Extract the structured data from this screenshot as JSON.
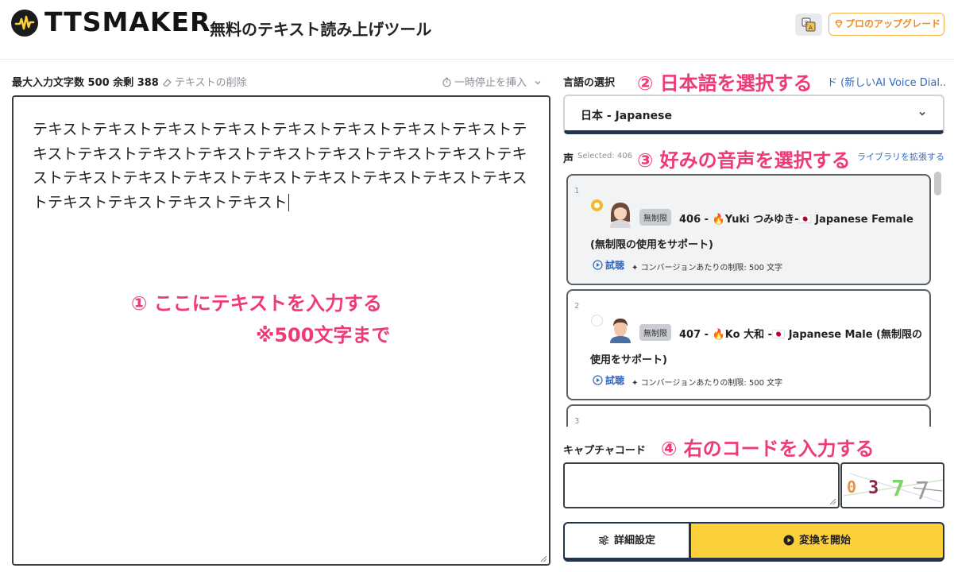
{
  "header": {
    "logo_text": "TTSMAKER",
    "title": "無料のテキスト読み上げツール",
    "upgrade_label": "プロのアップグレード"
  },
  "editor": {
    "max_chars_text": "最大入力文字数 500 余剰 388",
    "clear_label": "テキストの削除",
    "pause_label": "一時停止を挿入",
    "text": "テキストテキストテキストテキストテキストテキストテキストテキストテキストテキストテキストテキストテキストテキストテキストテキストテキストテキストテキストテキストテキストテキストテキストテキストテキストテキストテキストテキストテキスト"
  },
  "language": {
    "label": "言語の選択",
    "dialect_link": "ド (新しいAI Voice Dial...",
    "selected": "日本 - Japanese"
  },
  "voice": {
    "label": "声",
    "selected_text": "Selected: 406",
    "library_link": "ライブラリを拡張する",
    "items": [
      {
        "num": "1",
        "tag": "無制限",
        "name": "406 - 🔥Yuki つみゆき-🇯🇵 Japanese Female (無制限の使用をサポート)",
        "try_label": "試聴",
        "limit": "コンバージョンあたりの制限: 500 文字"
      },
      {
        "num": "2",
        "tag": "無制限",
        "name": "407 - 🔥Ko 大和 -🇯🇵 Japanese Male (無制限の使用をサポート)",
        "try_label": "試聴",
        "limit": "コンバージョンあたりの制限: 500 文字"
      },
      {
        "num": "3"
      }
    ]
  },
  "captcha": {
    "label": "キャプチャコード",
    "code": "0 3 7 7"
  },
  "actions": {
    "settings_label": "詳細設定",
    "start_label": "変換を開始"
  },
  "annotations": {
    "step1": "① ここにテキストを入力する",
    "step1_note": "※500文字まで",
    "step2": "② 日本語を選択する",
    "step3": "③ 好みの音声を選択する",
    "step4": "④ 右のコードを入力する"
  },
  "colors": {
    "accent_yellow": "#fbd03b",
    "annotation_pink": "#ef3a76",
    "link_blue": "#3169c4",
    "upgrade_orange": "#f08c1e"
  }
}
